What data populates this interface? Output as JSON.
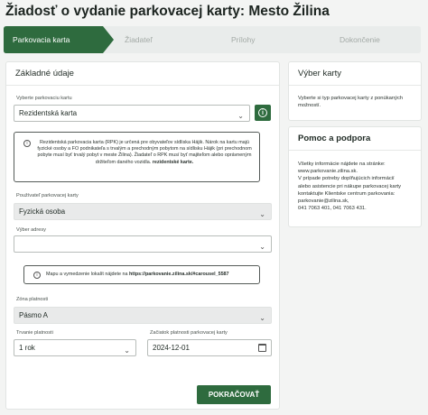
{
  "page_title": "Žiadosť o vydanie parkovacej karty: Mesto Žilina",
  "steps": [
    {
      "label": "Parkovacia karta",
      "active": true
    },
    {
      "label": "Žiadateľ",
      "active": false
    },
    {
      "label": "Prílohy",
      "active": false
    },
    {
      "label": "Dokončenie",
      "active": false
    }
  ],
  "colors": {
    "brand": "#2e6b3e",
    "step_inactive": "#e9eceb"
  },
  "main": {
    "title": "Základné údaje",
    "card_type": {
      "label": "Vyberte parkovaciu kartu",
      "value": "Rezidentská karta"
    },
    "note1": {
      "text": "Rezidentská parkovacia karta (RPK) je určená pre obyvateľov sídliska Hájik. Nárok na kartu majú fyzické osoby a FO podnikateľa s trvalým a prechodným pobytom na sídlisku Hájik (pri prechodnom pobyte musí byť trvalý pobyt v meste Žilina). Žiadateľ o RPK musí byť majiteľom alebo oprávneným držiteľom daného vozidla.",
      "bold": "rezidentské karte."
    },
    "user_type": {
      "label": "Používateľ parkovacej karty",
      "value": "Fyzická osoba"
    },
    "address": {
      "label": "Výber adresy",
      "value": ""
    },
    "note2": {
      "text": "Mapu a vymedzenie lokalít nájdete na",
      "link": "https://parkovanie.zilina.sk/#carousel_5587"
    },
    "zone": {
      "label": "Zóna platnosti",
      "value": "Pásmo A"
    },
    "duration": {
      "label": "Trvanie platnosti",
      "value": "1 rok"
    },
    "start_date": {
      "label": "Začiatok platnosti parkovacej karty",
      "value": "2024-12-01"
    },
    "submit_label": "POKRAČOVAŤ"
  },
  "side": {
    "card1": {
      "title": "Výber karty",
      "text": "Vyberte si typ parkovacej karty z ponúkaných možností."
    },
    "card2": {
      "title": "Pomoc a podpora",
      "lines": [
        "Všetky informácie nájdete na stránke:",
        "www.parkovanie.zilina.sk.",
        "V prípade potreby doplňujúcich informácií",
        "alebo asistencie pri nákupe parkovacej karty",
        "kontaktujte Klientske centrum parkovania:",
        "parkovanie@zilina.sk,",
        "041 7063 401, 041 7063 431."
      ]
    }
  }
}
